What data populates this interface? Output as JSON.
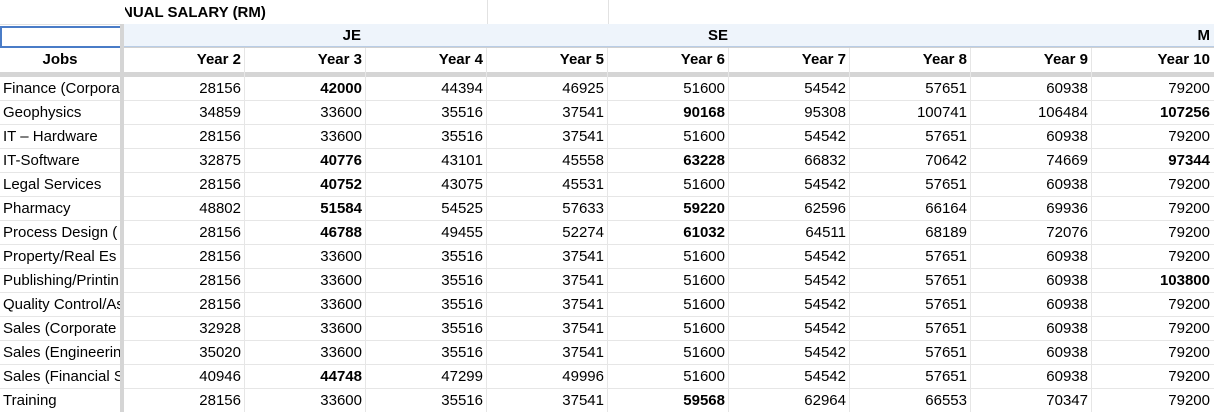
{
  "sheet": {
    "title": "NUAL SALARY (RM)",
    "groups": [
      {
        "label": "JE"
      },
      {
        "label": "SE"
      },
      {
        "label": "M"
      }
    ],
    "jobs_header": "Jobs",
    "year_headers": [
      "Year 2",
      "Year 3",
      "Year 4",
      "Year 5",
      "Year 6",
      "Year 7",
      "Year 8",
      "Year 9",
      "Year 10"
    ],
    "rows": [
      {
        "job": "Finance (Corpora",
        "values": [
          "28156",
          "42000",
          "44394",
          "46925",
          "51600",
          "54542",
          "57651",
          "60938",
          "79200"
        ],
        "bold": [
          1
        ]
      },
      {
        "job": "Geophysics",
        "values": [
          "34859",
          "33600",
          "35516",
          "37541",
          "90168",
          "95308",
          "100741",
          "106484",
          "107256"
        ],
        "bold": [
          4,
          8
        ]
      },
      {
        "job": "IT – Hardware",
        "values": [
          "28156",
          "33600",
          "35516",
          "37541",
          "51600",
          "54542",
          "57651",
          "60938",
          "79200"
        ],
        "bold": []
      },
      {
        "job": "IT-Software",
        "values": [
          "32875",
          "40776",
          "43101",
          "45558",
          "63228",
          "66832",
          "70642",
          "74669",
          "97344"
        ],
        "bold": [
          1,
          4,
          8
        ]
      },
      {
        "job": "Legal Services",
        "values": [
          "28156",
          "40752",
          "43075",
          "45531",
          "51600",
          "54542",
          "57651",
          "60938",
          "79200"
        ],
        "bold": [
          1
        ]
      },
      {
        "job": "Pharmacy",
        "values": [
          "48802",
          "51584",
          "54525",
          "57633",
          "59220",
          "62596",
          "66164",
          "69936",
          "79200"
        ],
        "bold": [
          1,
          4
        ]
      },
      {
        "job": "Process Design (",
        "values": [
          "28156",
          "46788",
          "49455",
          "52274",
          "61032",
          "64511",
          "68189",
          "72076",
          "79200"
        ],
        "bold": [
          1,
          4
        ]
      },
      {
        "job": "Property/Real Es",
        "values": [
          "28156",
          "33600",
          "35516",
          "37541",
          "51600",
          "54542",
          "57651",
          "60938",
          "79200"
        ],
        "bold": []
      },
      {
        "job": "Publishing/Printin",
        "values": [
          "28156",
          "33600",
          "35516",
          "37541",
          "51600",
          "54542",
          "57651",
          "60938",
          "103800"
        ],
        "bold": [
          8
        ]
      },
      {
        "job": "Quality Control/As",
        "values": [
          "28156",
          "33600",
          "35516",
          "37541",
          "51600",
          "54542",
          "57651",
          "60938",
          "79200"
        ],
        "bold": []
      },
      {
        "job": "Sales (Corporate",
        "values": [
          "32928",
          "33600",
          "35516",
          "37541",
          "51600",
          "54542",
          "57651",
          "60938",
          "79200"
        ],
        "bold": []
      },
      {
        "job": "Sales (Engineerin",
        "values": [
          "35020",
          "33600",
          "35516",
          "37541",
          "51600",
          "54542",
          "57651",
          "60938",
          "79200"
        ],
        "bold": []
      },
      {
        "job": "Sales (Financial S",
        "values": [
          "40946",
          "44748",
          "47299",
          "49996",
          "51600",
          "54542",
          "57651",
          "60938",
          "79200"
        ],
        "bold": [
          1
        ]
      },
      {
        "job": "Training",
        "values": [
          "28156",
          "33600",
          "35516",
          "37541",
          "59568",
          "62964",
          "66553",
          "70347",
          "79200"
        ],
        "bold": [
          4
        ]
      }
    ]
  },
  "colors": {
    "selection_border": "#4a7cc7",
    "group_fill": "#eef4fb",
    "freeze_bar": "#d5d5d5",
    "gridline": "#e6e6e6"
  }
}
